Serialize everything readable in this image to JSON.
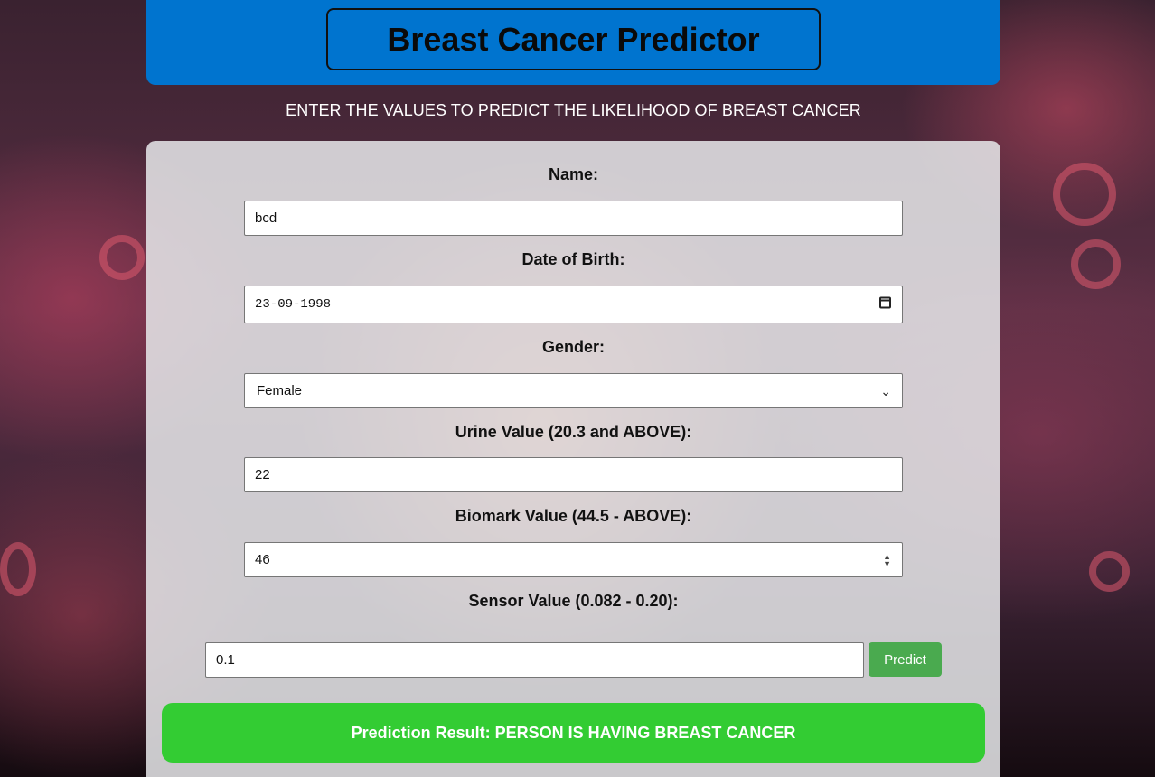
{
  "header": {
    "title": "Breast Cancer Predictor"
  },
  "subtitle": "ENTER THE VALUES TO PREDICT THE LIKELIHOOD OF BREAST CANCER",
  "form": {
    "name": {
      "label": "Name:",
      "value": "bcd"
    },
    "dob": {
      "label": "Date of Birth:",
      "value": "23-09-1998"
    },
    "gender": {
      "label": "Gender:",
      "value": "Female"
    },
    "urine": {
      "label": "Urine Value (20.3 and ABOVE):",
      "value": "22"
    },
    "biomark": {
      "label": "Biomark Value (44.5 - ABOVE):",
      "value": "46"
    },
    "sensor": {
      "label": "Sensor Value (0.082 - 0.20):",
      "value": "0.1"
    },
    "predict_label": "Predict"
  },
  "result": {
    "text": "Prediction Result: PERSON IS HAVING BREAST CANCER"
  },
  "colors": {
    "header": "#0074cf",
    "result": "#33cc33",
    "predict_button": "#4aaa4f"
  },
  "icons": [
    "calendar-icon",
    "chevron-down-icon",
    "spinner-icon"
  ]
}
